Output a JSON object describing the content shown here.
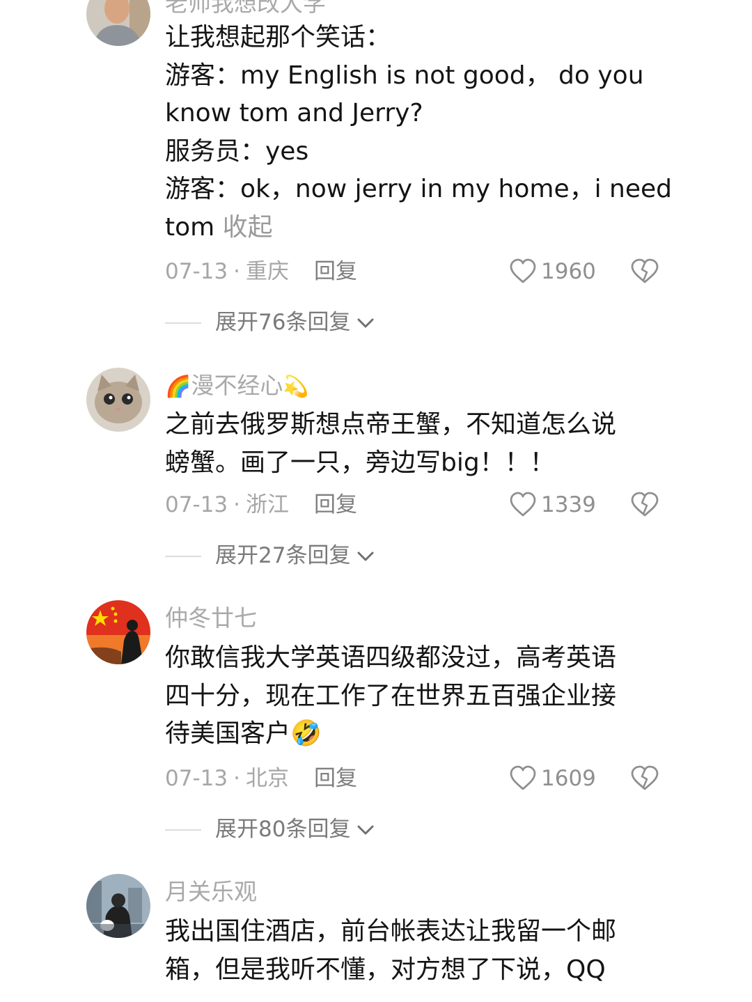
{
  "comments": [
    {
      "username": "老师我想改大学",
      "lines": [
        "让我想起那个笑话：",
        "游客：my English is not good， do you",
        "know tom and Jerry?",
        "服务员：yes",
        "游客：ok，now  jerry in my home，i need",
        "tom"
      ],
      "collapse_label": "收起",
      "date": "07-13",
      "location": "重庆",
      "reply_label": "回复",
      "likes": "1960",
      "expand_label": "展开76条回复"
    },
    {
      "username": "漫不经心",
      "username_prefix_emoji": "🌈",
      "username_suffix_emoji": "💫",
      "lines": [
        "之前去俄罗斯想点帝王蟹，不知道怎么说",
        "螃蟹。画了一只，旁边写big！！！"
      ],
      "date": "07-13",
      "location": "浙江",
      "reply_label": "回复",
      "likes": "1339",
      "expand_label": "展开27条回复"
    },
    {
      "username": "仲冬廿七",
      "lines": [
        "你敢信我大学英语四级都没过，高考英语",
        "四十分，现在工作了在世界五百强企业接",
        "待美国客户🤣"
      ],
      "date": "07-13",
      "location": "北京",
      "reply_label": "回复",
      "likes": "1609",
      "expand_label": "展开80条回复"
    },
    {
      "username": "月关乐观",
      "lines": [
        "我出国住酒店，前台帐表达让我留一个邮",
        "箱，但是我听不懂，对方想了下说，QQ"
      ]
    }
  ],
  "colors": {
    "text": "#141414",
    "muted": "#a6a6a6",
    "icon": "#8f8f8f"
  }
}
